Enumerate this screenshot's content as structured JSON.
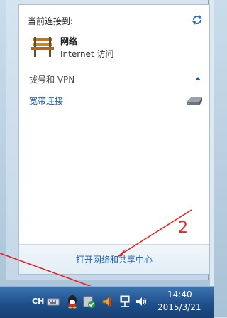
{
  "popup": {
    "header": "当前连接到:",
    "network_name": "网络",
    "network_status": "Internet 访问",
    "section_title": "拨号和 VPN",
    "broadband_link": "宽带连接",
    "footer_link": "打开网络和共享中心"
  },
  "annotation": {
    "number": "2",
    "color": "#e32626"
  },
  "taskbar": {
    "language": "CH",
    "time": "14:40",
    "date": "2015/3/21"
  },
  "colors": {
    "link": "#1a5ab5",
    "taskbar": "#1e4f8b",
    "annotation": "#e32626"
  },
  "icons": [
    "refresh-icon",
    "bench-network-icon",
    "collapse-chevron-icon",
    "modem-icon",
    "keyboard-icon",
    "qq-icon",
    "security-shield-icon",
    "speaker-muted-icon",
    "network-tray-icon",
    "volume-icon"
  ]
}
